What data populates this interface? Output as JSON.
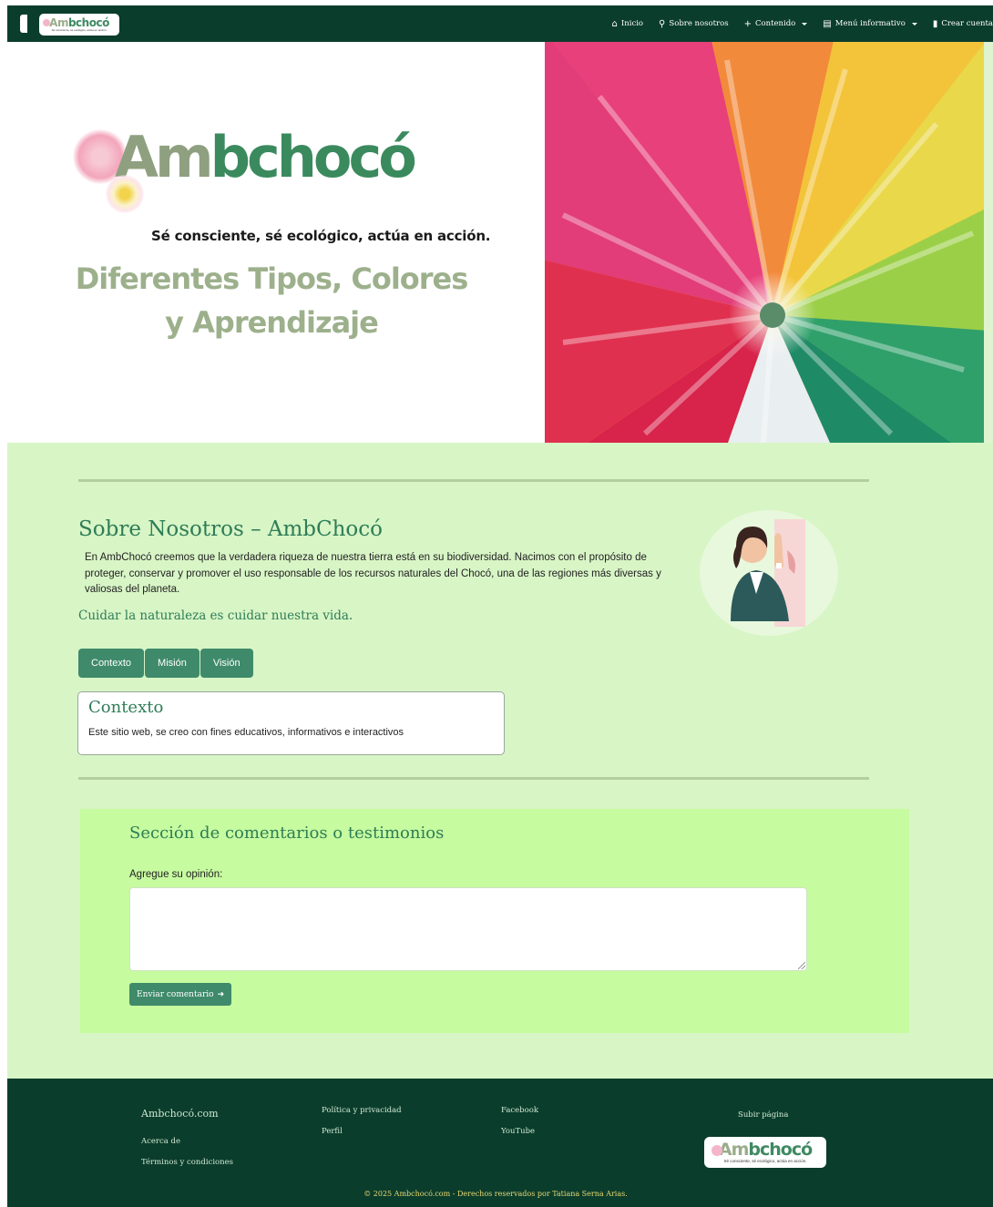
{
  "navbar": {
    "logo_word": "Ambchocó",
    "logo_slogan": "Sé consciente, sé ecológico, actúa en acción.",
    "items": [
      {
        "label": "Inicio",
        "icon": "home-icon"
      },
      {
        "label": "Sobre nosotros",
        "icon": "search-icon"
      },
      {
        "label": "Contenido",
        "icon": "plus-icon"
      },
      {
        "label": "Menú informativo",
        "icon": "book-icon"
      },
      {
        "label": "Crear cuenta",
        "icon": "door-icon"
      }
    ]
  },
  "hero": {
    "logo_word": "Ambchocó",
    "tagline": "Sé consciente, sé ecológico, actúa en acción.",
    "title_line1": "Diferentes Tipos, Colores",
    "title_line2": "y Aprendizaje"
  },
  "about": {
    "title": "Sobre Nosotros – AmbChocó",
    "text": "En AmbChocó creemos que la verdadera riqueza de nuestra tierra está en su biodiversidad. Nacimos con el propósito de proteger, conservar y promover el uso responsable de los recursos naturales del Chocó, una de las regiones más diversas y valiosas del planeta.",
    "quote": "Cuidar la naturaleza es cuidar nuestra vida.",
    "tabs": [
      "Contexto",
      "Misión",
      "Visión"
    ],
    "card_title": "Contexto",
    "card_text": "Este sitio web, se creo con fines educativos, informativos e interactivos"
  },
  "comments": {
    "title": "Sección de comentarios o testimonios",
    "label": "Agregue su opinión:",
    "value": "",
    "button": "Enviar comentario"
  },
  "footer": {
    "brand": "Ambchocó.com",
    "col1": [
      "Acerca de",
      "Términos y condiciones"
    ],
    "col2": [
      "Política y privacidad",
      "Perfil"
    ],
    "col3": [
      "Facebook",
      "YouTube"
    ],
    "scroll_top": "Subir página",
    "logo_word": "Ambchocó",
    "logo_slogan": "Sé consciente, sé ecológico, actúa en acción.",
    "copyright": "© 2025 Ambchocó.com - Derechos reservados por Tatiana Serna Arias."
  },
  "colors": {
    "nav_bg": "#0b3d2c",
    "main_bg": "#d8f5c6",
    "comments_bg": "#c6fb9f",
    "accent": "#2e7d57",
    "button": "#3e8a6a"
  }
}
